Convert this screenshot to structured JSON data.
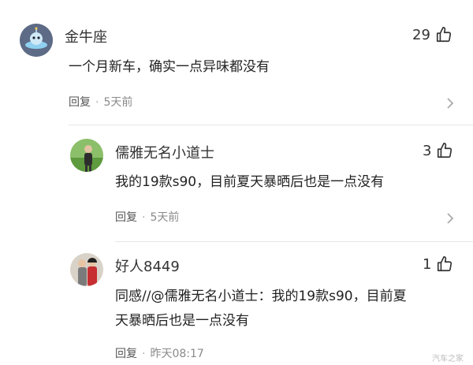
{
  "comments": [
    {
      "username": "金牛座",
      "likes": "29",
      "text": "一个月新车，确实一点异味都没有",
      "reply_label": "回复",
      "time": "5天前",
      "avatar_icon": "robot-avatar-icon"
    },
    {
      "username": "儒雅无名小道士",
      "likes": "3",
      "text": "我的19款s90，目前夏天暴晒后也是一点没有",
      "reply_label": "回复",
      "time": "5天前",
      "avatar_icon": "person-photo-avatar"
    },
    {
      "username": "好人8449",
      "likes": "1",
      "text_line1": "同感//@儒雅无名小道士：我的19款s90，目前夏",
      "text_line2": "天暴晒后也是一点没有",
      "reply_label": "回复",
      "time": "昨天08:17",
      "avatar_icon": "couple-photo-avatar"
    }
  ],
  "watermark": "汽车之家",
  "colors": {
    "meta": "#8a8a8a",
    "text": "#222222",
    "divider": "#e6e6e6"
  }
}
